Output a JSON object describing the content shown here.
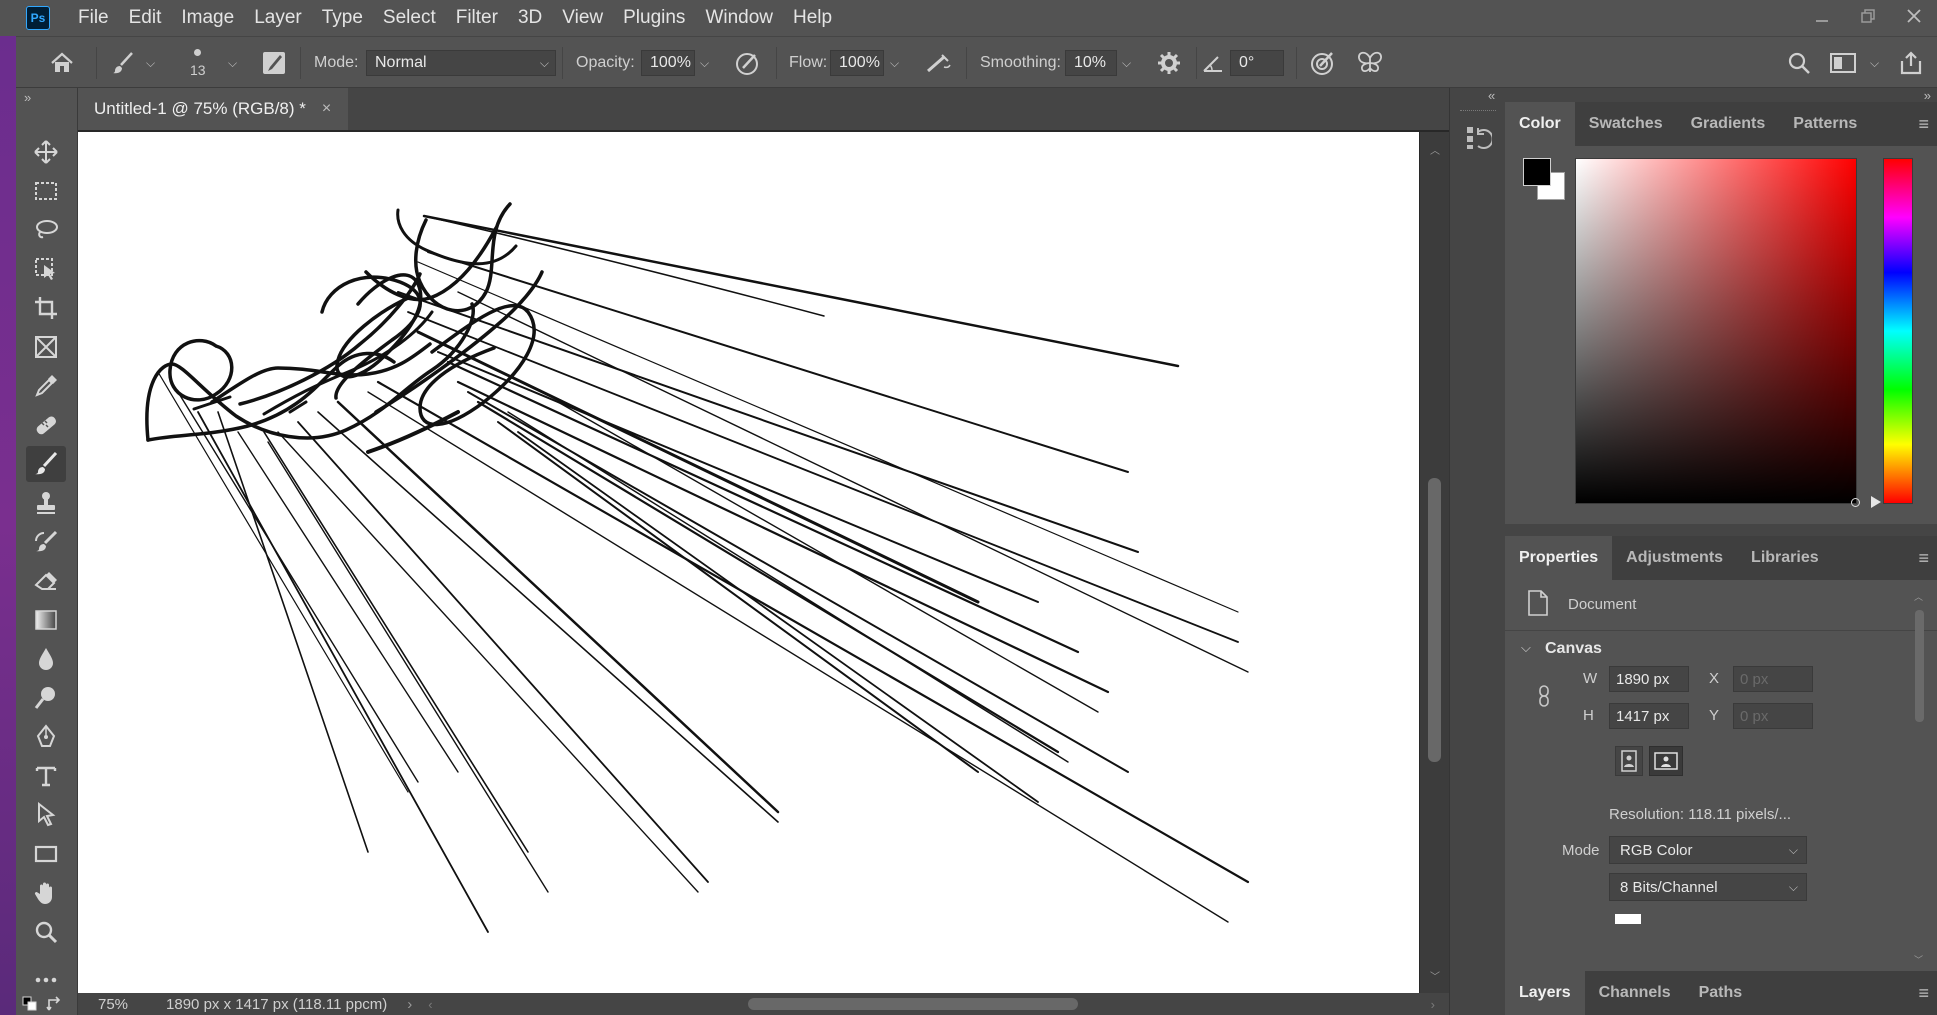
{
  "app": {
    "logo": "Ps"
  },
  "menu": [
    "File",
    "Edit",
    "Image",
    "Layer",
    "Type",
    "Select",
    "Filter",
    "3D",
    "View",
    "Plugins",
    "Window",
    "Help"
  ],
  "window_controls": [
    "minimize-icon",
    "restore-icon",
    "close-icon"
  ],
  "options": {
    "brush_size": "13",
    "mode_label": "Mode:",
    "mode_value": "Normal",
    "opacity_label": "Opacity:",
    "opacity_value": "100%",
    "flow_label": "Flow:",
    "flow_value": "100%",
    "smoothing_label": "Smoothing:",
    "smoothing_value": "10%",
    "angle_value": "0°"
  },
  "document": {
    "tab_title": "Untitled-1 @ 75% (RGB/8) *",
    "close": "×"
  },
  "status": {
    "zoom": "75%",
    "info": "1890 px x 1417 px (118.11 ppcm)",
    "arrow": "›"
  },
  "color_panel": {
    "tabs": [
      "Color",
      "Swatches",
      "Gradients",
      "Patterns"
    ],
    "active_tab": 0,
    "foreground": "#000000",
    "background": "#ffffff",
    "hue": "#ff0000"
  },
  "properties_panel": {
    "tabs": [
      "Properties",
      "Adjustments",
      "Libraries"
    ],
    "active_tab": 0,
    "section": "Document",
    "canvas_header": "Canvas",
    "w_label": "W",
    "w_value": "1890 px",
    "h_label": "H",
    "h_value": "1417 px",
    "x_label": "X",
    "x_placeholder": "0 px",
    "y_label": "Y",
    "y_placeholder": "0 px",
    "resolution": "Resolution:  118.11 pixels/...",
    "mode_label": "Mode",
    "mode_value": "RGB Color",
    "bits_value": "8 Bits/Channel"
  },
  "layers_panel": {
    "tabs": [
      "Layers",
      "Channels",
      "Paths"
    ],
    "active_tab": 0
  },
  "tools": [
    "move-tool",
    "marquee-tool",
    "lasso-tool",
    "object-select-tool",
    "crop-tool",
    "frame-tool",
    "eyedropper-tool",
    "healing-tool",
    "brush-tool",
    "stamp-tool",
    "history-brush-tool",
    "eraser-tool",
    "gradient-tool",
    "blur-tool",
    "dodge-tool",
    "pen-tool",
    "type-tool",
    "path-select-tool",
    "rectangle-tool",
    "hand-tool",
    "zoom-tool",
    "more-tools"
  ]
}
